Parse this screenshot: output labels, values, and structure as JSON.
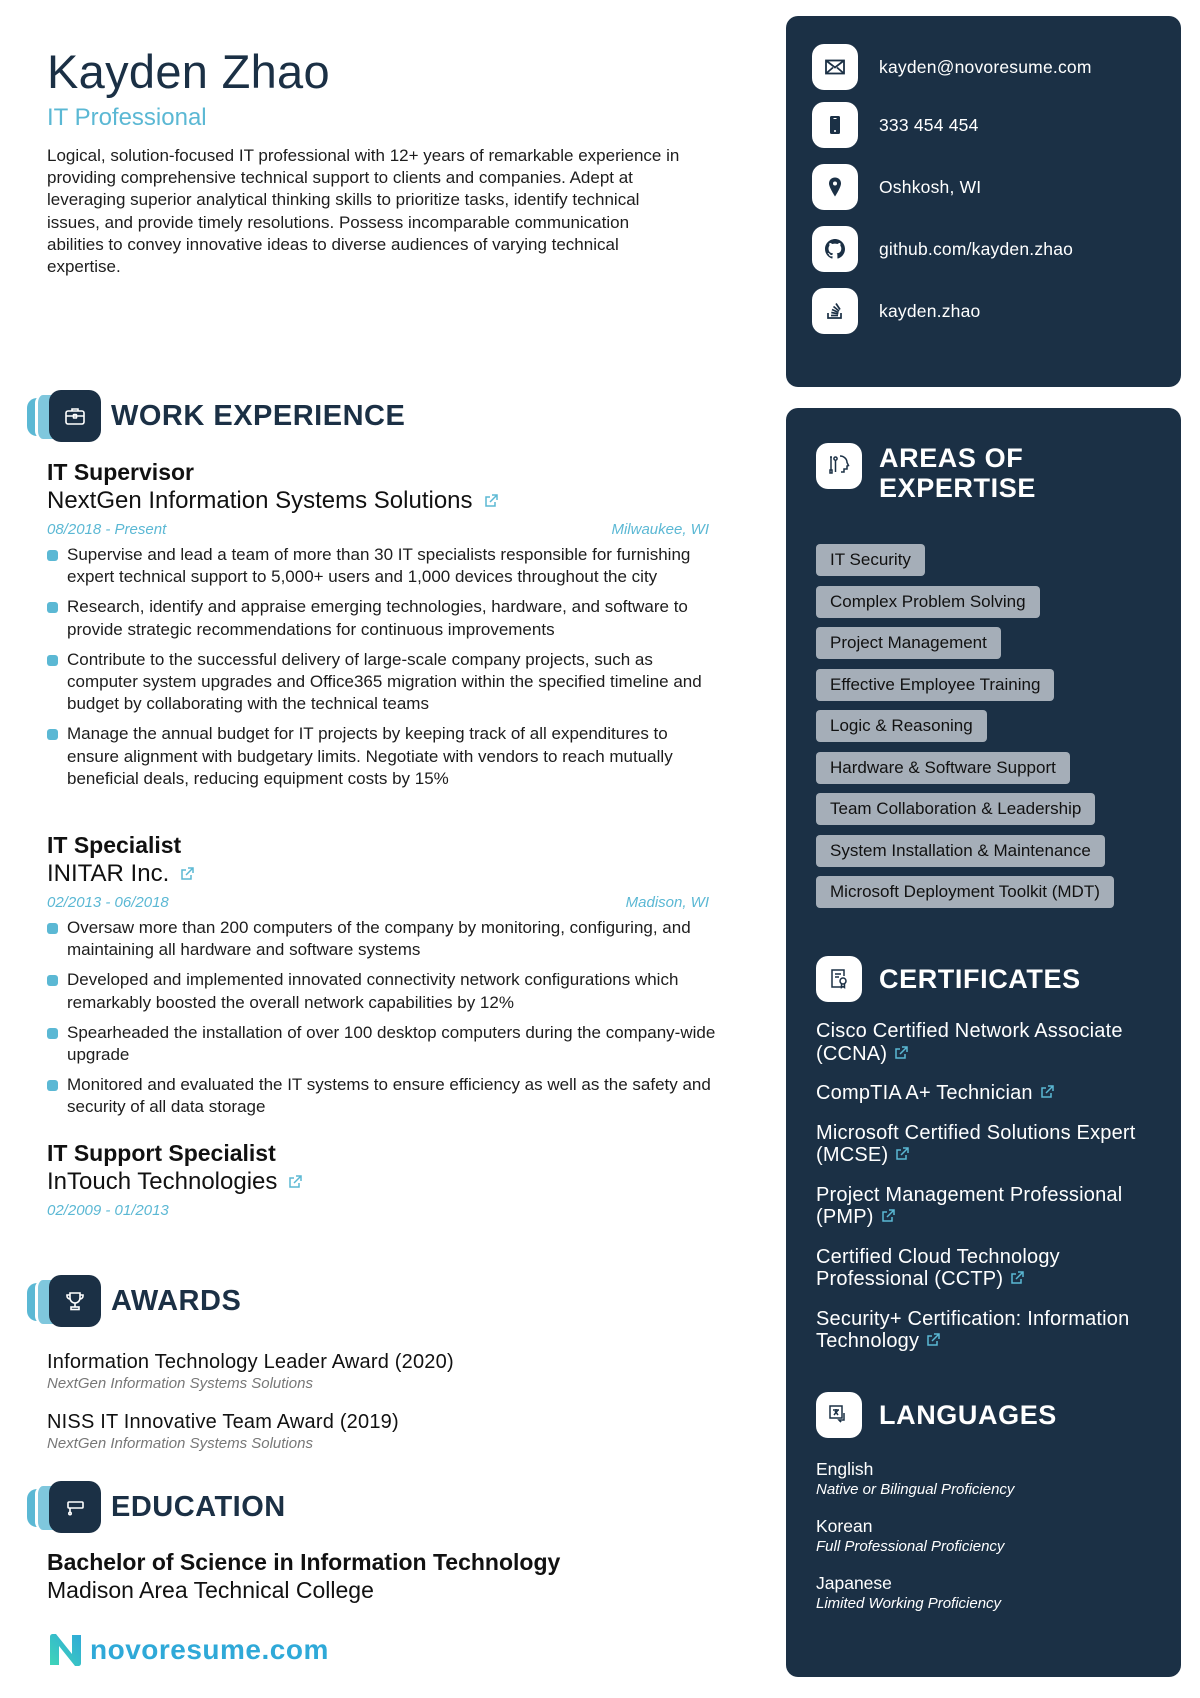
{
  "header": {
    "name": "Kayden Zhao",
    "title": "IT Professional",
    "summary": "Logical, solution-focused IT professional with 12+ years of remarkable experience in providing comprehensive technical support to clients and companies. Adept at leveraging superior analytical thinking skills to prioritize tasks, identify technical issues, and provide timely resolutions. Possess incomparable communication abilities to convey innovative ideas to diverse audiences of varying technical expertise."
  },
  "colors": {
    "navy": "#1b3045",
    "accent": "#5bb8d4",
    "tag_bg": "#a5aeb8"
  },
  "contact": [
    {
      "icon": "envelope-icon",
      "text": "kayden@novoresume.com"
    },
    {
      "icon": "phone-icon",
      "text": "333 454 454"
    },
    {
      "icon": "location-pin-icon",
      "text": "Oshkosh, WI"
    },
    {
      "icon": "github-icon",
      "text": "github.com/kayden.zhao"
    },
    {
      "icon": "stackoverflow-icon",
      "text": "kayden.zhao"
    }
  ],
  "work": {
    "heading": "WORK EXPERIENCE",
    "icon": "briefcase-icon",
    "jobs": [
      {
        "role": "IT Supervisor",
        "company": "NextGen Information Systems Solutions",
        "dates": "08/2018 - Present",
        "location": "Milwaukee, WI",
        "bullets": [
          "Supervise and lead a team of more than 30 IT specialists responsible for furnishing expert technical support to 5,000+ users and 1,000 devices throughout the city",
          "Research, identify and appraise emerging technologies, hardware, and software to provide strategic recommendations for continuous improvements",
          "Contribute to the successful delivery of large-scale company projects, such as computer system upgrades and Office365 migration within the specified timeline and budget by collaborating with the technical teams",
          "Manage the annual budget for IT projects by keeping track of all expenditures to ensure alignment with budgetary limits. Negotiate with vendors to reach mutually beneficial deals, reducing equipment costs by 15%"
        ]
      },
      {
        "role": "IT Specialist",
        "company": "INITAR Inc.",
        "dates": "02/2013 - 06/2018",
        "location": "Madison, WI",
        "bullets": [
          "Oversaw more than 200 computers of the company by monitoring, configuring, and maintaining all hardware and software systems",
          "Developed and implemented innovated connectivity network configurations which remarkably boosted the overall network capabilities by 12%",
          "Spearheaded the installation of over 100 desktop computers during the company-wide upgrade",
          "Monitored and evaluated the IT systems to ensure efficiency as well as the safety and security of all data storage"
        ]
      },
      {
        "role": "IT Support Specialist",
        "company": "InTouch Technologies",
        "dates": "02/2009 - 01/2013",
        "location": ""
      }
    ]
  },
  "awards": {
    "heading": "AWARDS",
    "icon": "trophy-icon",
    "items": [
      {
        "name": "Information Technology Leader Award (2020)",
        "org": "NextGen Information Systems Solutions"
      },
      {
        "name": "NISS IT Innovative Team Award (2019)",
        "org": "NextGen Information Systems Solutions"
      }
    ]
  },
  "education": {
    "heading": "EDUCATION",
    "icon": "graduation-cap-icon",
    "degree": "Bachelor of Science in Information Technology",
    "school": "Madison Area Technical College"
  },
  "footer": {
    "logo_text": "novoresume.com"
  },
  "expertise": {
    "heading": "AREAS OF EXPERTISE",
    "heading_line1": "AREAS OF",
    "heading_line2": "EXPERTISE",
    "icon": "tools-head-icon",
    "skills": [
      "IT Security",
      "Complex Problem Solving",
      "Project Management",
      "Effective Employee Training",
      "Logic & Reasoning",
      "Hardware & Software Support",
      "Team Collaboration & Leadership",
      "System Installation & Maintenance",
      "Microsoft Deployment Toolkit (MDT)"
    ]
  },
  "certificates": {
    "heading": "CERTIFICATES",
    "icon": "certificate-icon",
    "items": [
      "Cisco Certified Network Associate (CCNA)",
      "CompTIA A+ Technician",
      "Microsoft Certified Solutions Expert (MCSE)",
      "Project Management Professional (PMP)",
      "Certified Cloud Technology Professional (CCTP)",
      "Security+ Certification: Information Technology"
    ]
  },
  "languages": {
    "heading": "LANGUAGES",
    "icon": "translate-icon",
    "items": [
      {
        "name": "English",
        "level": "Native or Bilingual Proficiency"
      },
      {
        "name": "Korean",
        "level": "Full Professional Proficiency"
      },
      {
        "name": "Japanese",
        "level": "Limited Working Proficiency"
      }
    ]
  }
}
